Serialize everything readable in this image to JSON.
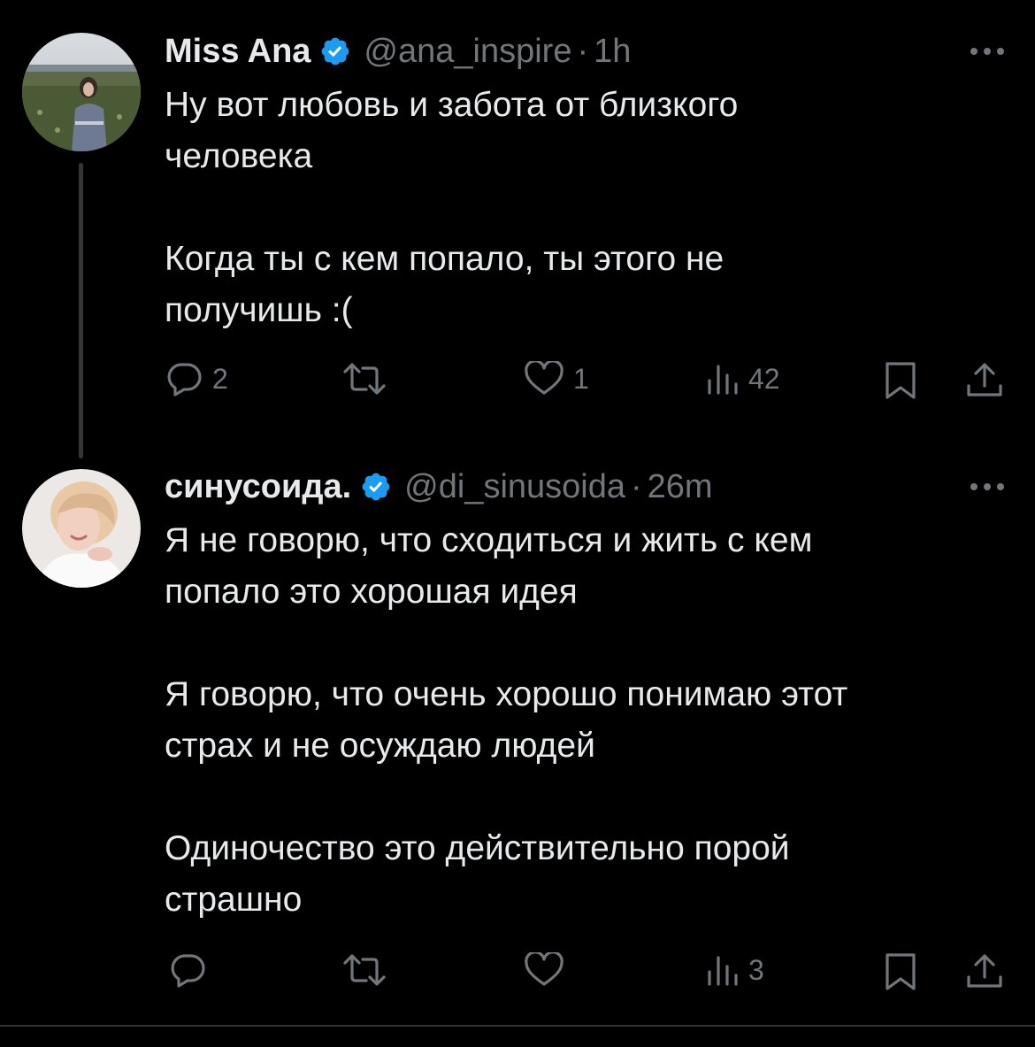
{
  "tweets": [
    {
      "name": "Miss Ana",
      "handle": "@ana_inspire",
      "separator": "·",
      "time": "1h",
      "text": "Ну вот любовь и забота от близкого\nчеловека\n\nКогда ты с кем попало, ты этого не\nполучишь :(",
      "replies": "2",
      "retweets": "",
      "likes": "1",
      "views": "42",
      "icons": [
        "verified-badge-icon",
        "more-icon",
        "reply-icon",
        "retweet-icon",
        "like-icon",
        "views-icon",
        "bookmark-icon",
        "share-icon"
      ]
    },
    {
      "name": "синусоида.",
      "handle": "@di_sinusoida",
      "separator": "·",
      "time": "26m",
      "text": "Я не говорю, что сходиться и жить с кем\nпопало это хорошая идея\n\nЯ говорю, что очень хорошо понимаю этот\nстрах и не осуждаю людей\n\nОдиночество это действительно порой\nстрашно",
      "replies": "",
      "retweets": "",
      "likes": "",
      "views": "3",
      "icons": [
        "verified-badge-icon",
        "more-icon",
        "reply-icon",
        "retweet-icon",
        "like-icon",
        "views-icon",
        "bookmark-icon",
        "share-icon"
      ]
    }
  ],
  "colors": {
    "background": "#000000",
    "text": "#e7e9ea",
    "secondary": "#71767b",
    "verified": "#1d9bf0",
    "divider": "#2f3336"
  }
}
